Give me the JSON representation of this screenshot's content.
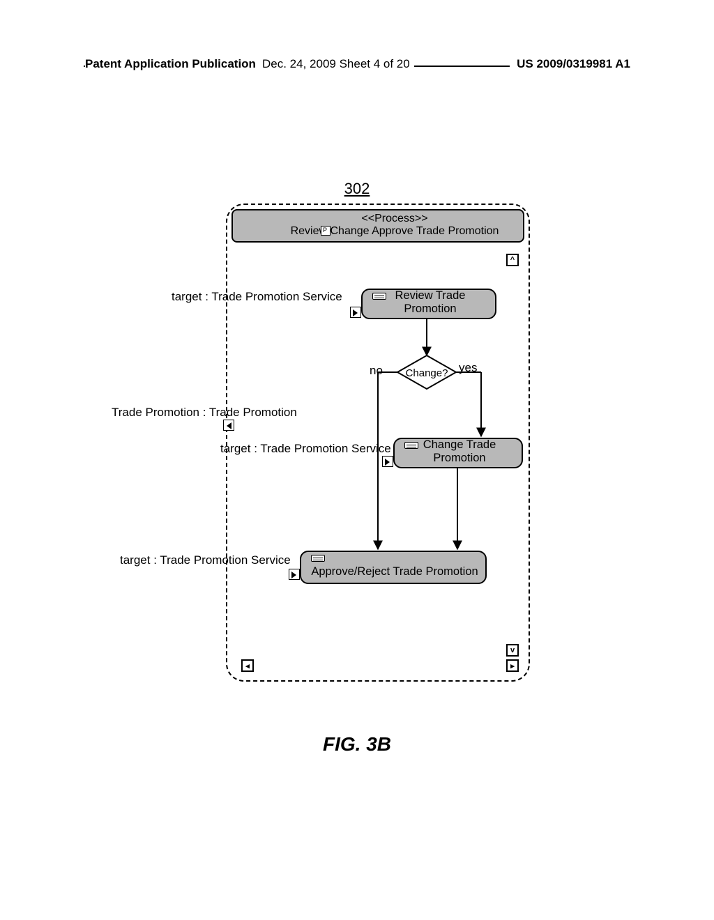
{
  "header": {
    "left": "Patent Application Publication",
    "middle": "Dec. 24, 2009  Sheet 4 of 20",
    "right": "US 2009/0319981 A1"
  },
  "figure": {
    "ref_number": "302",
    "caption": "FIG. 3B"
  },
  "process": {
    "stereotype": "<<Process>>",
    "title": "Review/Change Approve Trade Promotion"
  },
  "labels": {
    "target_tps_1": "target : Trade Promotion Service",
    "trade_promotion_pin": "Trade Promotion : Trade Promotion",
    "target_tps_2": "target : Trade Promotion Service",
    "target_tps_3": "target : Trade Promotion Service"
  },
  "decision": {
    "text": "Change?",
    "no": "no",
    "yes": "yes"
  },
  "boxes": {
    "review": "Review Trade Promotion",
    "change": "Change Trade Promotion",
    "approve": "Approve/Reject Trade Promotion"
  }
}
